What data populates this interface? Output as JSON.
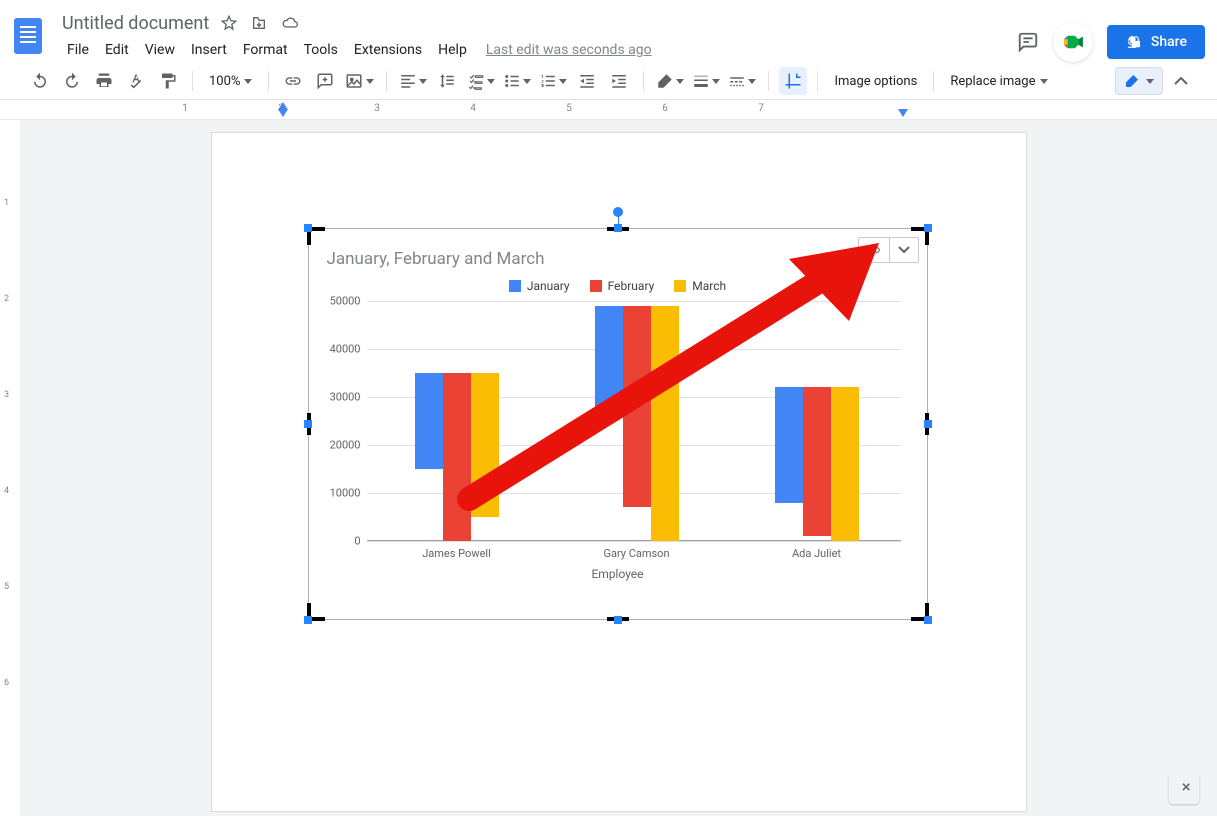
{
  "header": {
    "title": "Untitled document",
    "last_edit": "Last edit was seconds ago",
    "share_label": "Share"
  },
  "menus": [
    "File",
    "Edit",
    "View",
    "Insert",
    "Format",
    "Tools",
    "Extensions",
    "Help"
  ],
  "toolbar": {
    "zoom": "100%",
    "image_options": "Image options",
    "replace_image": "Replace image"
  },
  "ruler": {
    "hlabels": [
      "1",
      "2",
      "3",
      "4",
      "5",
      "6",
      "7"
    ],
    "vlabels": [
      "1",
      "2",
      "3",
      "4",
      "5",
      "6"
    ]
  },
  "chart_data": {
    "type": "bar",
    "title": "January, February and March",
    "xlabel": "Employee",
    "ylabel": "",
    "ylim": [
      0,
      50000
    ],
    "yticks": [
      0,
      10000,
      20000,
      30000,
      40000,
      50000
    ],
    "categories": [
      "James Powell",
      "Gary Camson",
      "Ada Juliet"
    ],
    "series": [
      {
        "name": "January",
        "color": "#4285f4",
        "values": [
          20000,
          22000,
          24000
        ]
      },
      {
        "name": "February",
        "color": "#ea4335",
        "values": [
          35000,
          42000,
          31000
        ]
      },
      {
        "name": "March",
        "color": "#fbbc04",
        "values": [
          30000,
          49000,
          32000
        ]
      }
    ]
  }
}
